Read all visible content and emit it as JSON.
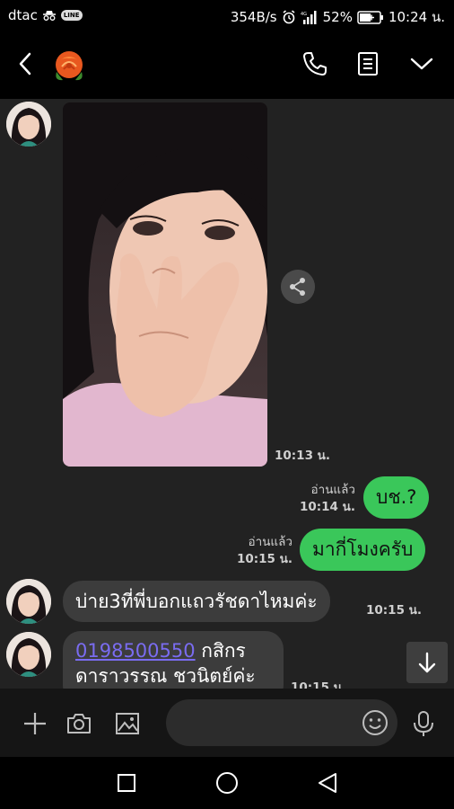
{
  "status": {
    "carrier": "dtac",
    "line_badge": "LINE",
    "net_speed": "354B/s",
    "battery": "52%",
    "time": "10:24 น."
  },
  "chat": {
    "photo_time": "10:13 น.",
    "out_messages": [
      {
        "read": "อ่านแล้ว",
        "time": "10:14 น.",
        "text": "บช.?"
      },
      {
        "read": "อ่านแล้ว",
        "time": "10:15 น.",
        "text": "มากี่โมงครับ"
      }
    ],
    "in_messages": [
      {
        "text": "บ่าย3ที่พี่บอกแถวรัชดาไหมค่ะ",
        "time": "10:15 น."
      },
      {
        "account": "0198500550",
        "text_tail": " กสิกร",
        "line2": "ดาราวรรณ ชวนิตย์ค่ะ",
        "time": "10:15 น."
      }
    ]
  },
  "icons": {
    "back": "back-arrow-icon",
    "contact": "rose-avatar-icon",
    "call": "phone-icon",
    "notes": "notes-icon",
    "menu": "chevron-down-icon",
    "share": "share-icon",
    "scroll": "arrow-down-icon",
    "add": "plus-icon",
    "camera": "camera-icon",
    "gallery": "image-icon",
    "emoji": "emoji-icon",
    "mic": "microphone-icon"
  },
  "colors": {
    "bubble_out": "#3ac75a",
    "bubble_in": "#3c3c3c",
    "link": "#7a6cf0",
    "background": "#222222"
  }
}
